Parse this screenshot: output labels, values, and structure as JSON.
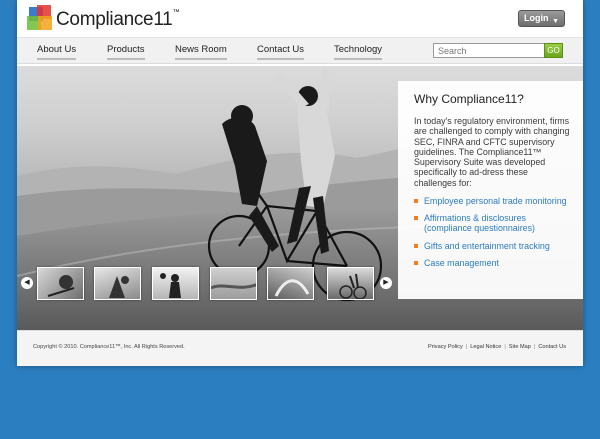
{
  "header": {
    "logo_text": "Compliance11",
    "logo_tm": "™",
    "login_label": "Login",
    "login_caret_icon": "caret-down-icon"
  },
  "nav": {
    "items": [
      {
        "label": "About Us"
      },
      {
        "label": "Products"
      },
      {
        "label": "News Room"
      },
      {
        "label": "Contact Us"
      },
      {
        "label": "Technology"
      }
    ],
    "search_placeholder": "Search",
    "go_label": "GO"
  },
  "hero": {
    "info": {
      "title": "Why Compliance11?",
      "body": "In today's regulatory environment, firms are challenged to comply with changing SEC, FINRA and CFTC supervisory guidelines. The Compliance11™ Supervisory Suite was developed specifically to ad-dress these challenges for:",
      "features": [
        "Employee personal trade monitoring",
        "Affirmations & disclosures (compliance questionnaires)",
        "Gifts and entertainment tracking",
        "Case management"
      ]
    },
    "thumbnails": [
      {
        "icon": "photo-thumbnail-1"
      },
      {
        "icon": "photo-thumbnail-2"
      },
      {
        "icon": "photo-thumbnail-3"
      },
      {
        "icon": "photo-thumbnail-4"
      },
      {
        "icon": "photo-thumbnail-5"
      },
      {
        "icon": "photo-thumbnail-6"
      }
    ],
    "prev_icon": "chevron-left-icon",
    "next_icon": "chevron-right-icon"
  },
  "footer": {
    "copyright": "Copyright © 2010. Compliance11™, Inc. All Rights Reserved.",
    "links": [
      "Privacy Policy",
      "Legal Notice",
      "Site Map",
      "Contact Us"
    ]
  },
  "colors": {
    "background": "#2b7fc1",
    "accent_orange": "#f07d1e",
    "link_blue": "#2c7cc1",
    "go_green": "#7bb52a"
  }
}
